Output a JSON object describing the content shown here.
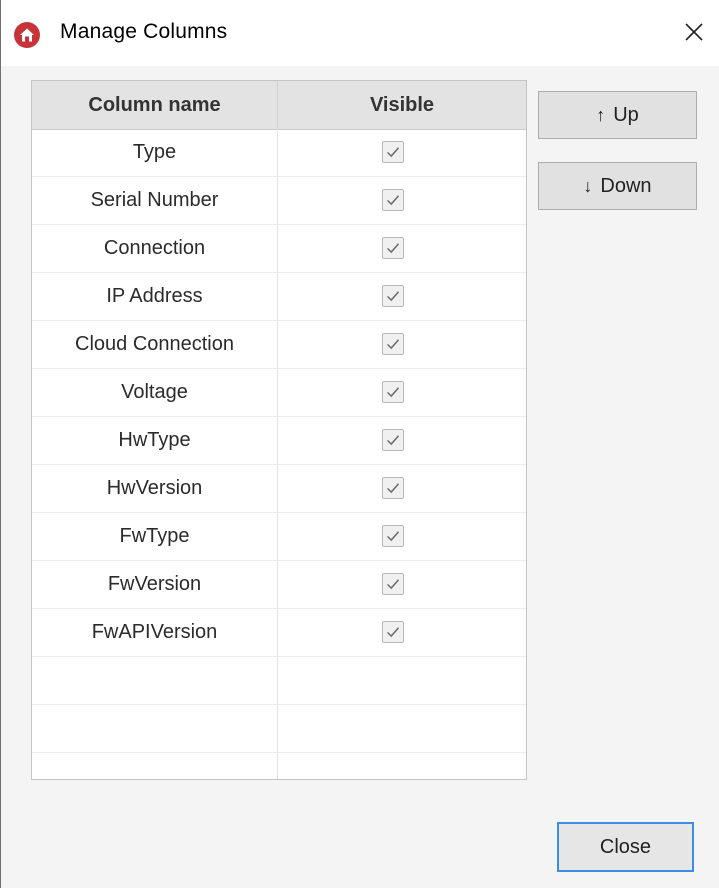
{
  "window": {
    "title": "Manage Columns",
    "accent_color": "#c8333a"
  },
  "table": {
    "headers": {
      "column_name": "Column name",
      "visible": "Visible"
    },
    "rows": [
      {
        "name": "Type",
        "visible": true
      },
      {
        "name": "Serial Number",
        "visible": true
      },
      {
        "name": "Connection",
        "visible": true
      },
      {
        "name": "IP Address",
        "visible": true
      },
      {
        "name": "Cloud Connection",
        "visible": true
      },
      {
        "name": "Voltage",
        "visible": true
      },
      {
        "name": "HwType",
        "visible": true
      },
      {
        "name": "HwVersion",
        "visible": true
      },
      {
        "name": "FwType",
        "visible": true
      },
      {
        "name": "FwVersion",
        "visible": true
      },
      {
        "name": "FwAPIVersion",
        "visible": true
      }
    ]
  },
  "buttons": {
    "up_label": "Up",
    "up_icon": "arrow-up-icon",
    "down_label": "Down",
    "down_icon": "arrow-down-icon",
    "close_label": "Close"
  }
}
